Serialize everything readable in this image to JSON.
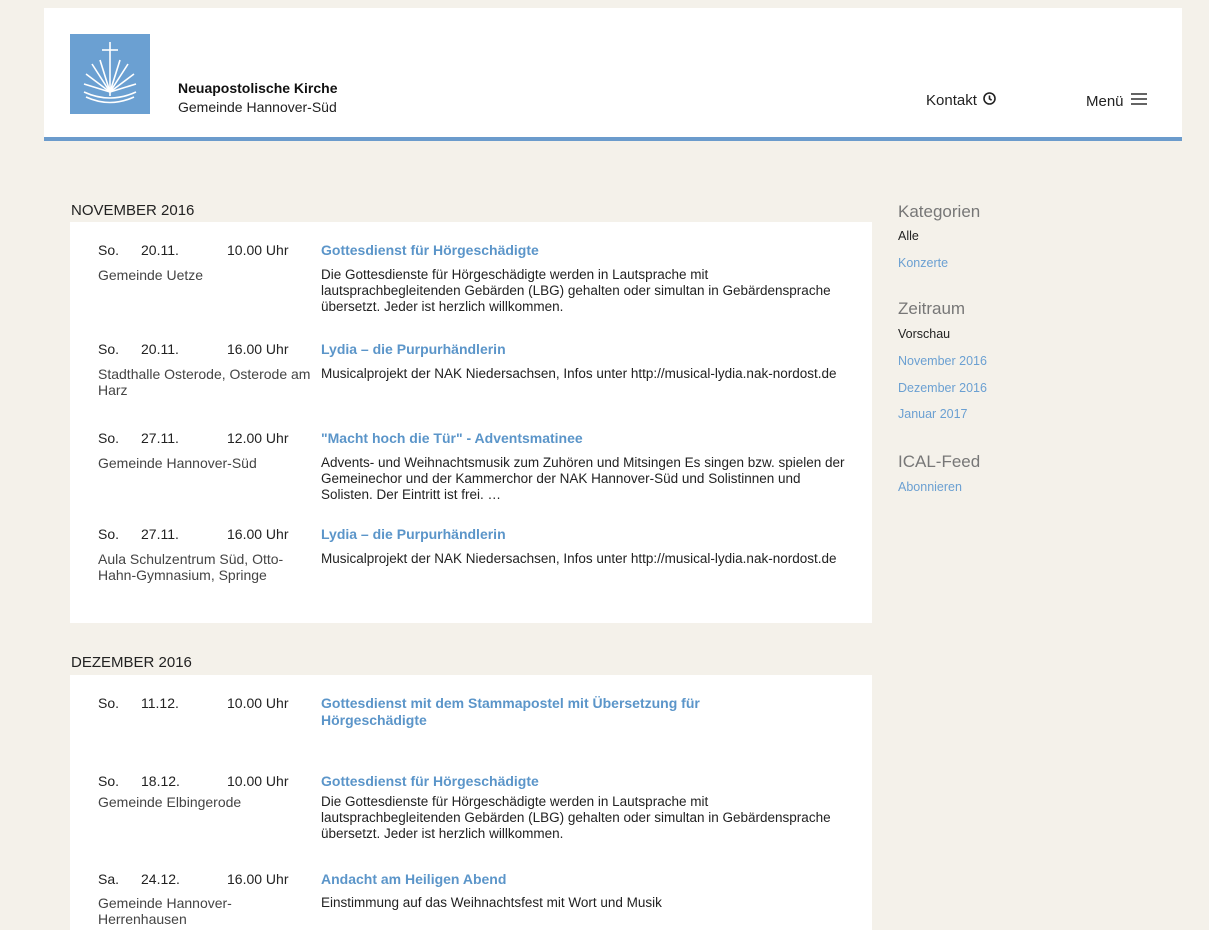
{
  "brand": {
    "title": "Neuapostolische Kirche",
    "subtitle": "Gemeinde Hannover-Süd",
    "logo_icon": "nak-cross-logo-icon",
    "accent": "#6ba0d2"
  },
  "nav": {
    "contact_label": "Kontakt",
    "contact_icon": "clock-icon",
    "menu_label": "Menü",
    "menu_icon": "hamburger-icon"
  },
  "months": [
    {
      "heading": "NOVEMBER 2016",
      "events": [
        {
          "day": "So.",
          "date": "20.11.",
          "time": "10.00 Uhr",
          "title": "Gottesdienst für Hörgeschädigte",
          "location": "Gemeinde Uetze",
          "description": "Die Gottesdienste für Hörgeschädigte werden in Lautsprache mit lautsprachbegleitenden Gebärden (LBG) gehalten oder simultan in Gebärdensprache übersetzt. Jeder ist herzlich willkommen."
        },
        {
          "day": "So.",
          "date": "20.11.",
          "time": "16.00 Uhr",
          "title": "Lydia – die Purpurhändlerin",
          "location": "Stadthalle Osterode, Osterode am Harz",
          "description": "Musicalprojekt der NAK Niedersachsen, Infos unter http://musical-lydia.nak-nordost.de"
        },
        {
          "day": "So.",
          "date": "27.11.",
          "time": "12.00 Uhr",
          "title": "\"Macht hoch die Tür\" - Adventsmatinee",
          "location": "Gemeinde Hannover-Süd",
          "description": "Advents- und Weihnachtsmusik zum Zuhören und Mitsingen Es singen bzw. spielen der Gemeinechor und der Kammerchor der NAK Hannover-Süd und Solistinnen und Solisten. Der Eintritt ist frei. …"
        },
        {
          "day": "So.",
          "date": "27.11.",
          "time": "16.00 Uhr",
          "title": "Lydia – die Purpurhändlerin",
          "location": "Aula Schulzentrum Süd, Otto-Hahn-Gymnasium, Springe",
          "description": "Musicalprojekt der NAK Niedersachsen, Infos unter http://musical-lydia.nak-nordost.de"
        }
      ]
    },
    {
      "heading": "DEZEMBER 2016",
      "events": [
        {
          "day": "So.",
          "date": "11.12.",
          "time": "10.00 Uhr",
          "title": "Gottesdienst mit dem Stammapostel mit Übersetzung für Hörgeschädigte",
          "location": "",
          "description": ""
        },
        {
          "day": "So.",
          "date": "18.12.",
          "time": "10.00 Uhr",
          "title": "Gottesdienst für Hörgeschädigte",
          "location": "Gemeinde Elbingerode",
          "description": "Die Gottesdienste für Hörgeschädigte werden in Lautsprache mit lautsprachbegleitenden Gebärden (LBG) gehalten oder simultan in Gebärdensprache übersetzt. Jeder ist herzlich willkommen."
        },
        {
          "day": "Sa.",
          "date": "24.12.",
          "time": "16.00 Uhr",
          "title": "Andacht am Heiligen Abend",
          "location": "Gemeinde Hannover-Herrenhausen",
          "description": "Einstimmung auf das Weihnachtsfest mit Wort und Musik"
        }
      ]
    }
  ],
  "sidebar": {
    "categories_heading": "Kategorien",
    "categories": [
      "Alle",
      "Konzerte"
    ],
    "period_heading": "Zeitraum",
    "periods": [
      "Vorschau",
      "November 2016",
      "Dezember 2016",
      "Januar 2017"
    ],
    "ical_heading": "ICAL-Feed",
    "ical_link": "Abonnieren"
  }
}
